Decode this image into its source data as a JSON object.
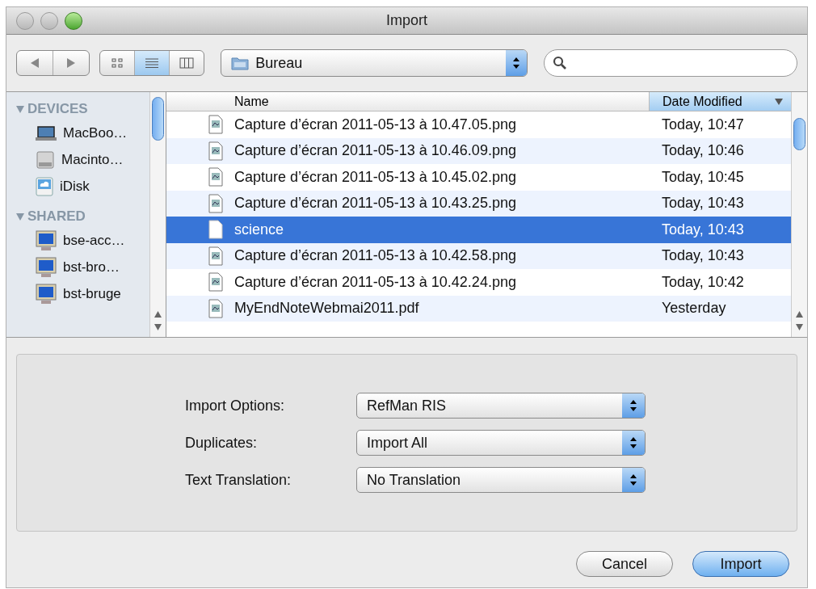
{
  "window": {
    "title": "Import"
  },
  "toolbar": {
    "view_modes": [
      {
        "kind": "icons",
        "selected": false
      },
      {
        "kind": "list",
        "selected": true
      },
      {
        "kind": "columns",
        "selected": false
      }
    ],
    "location": "Bureau"
  },
  "sidebar": {
    "sections": [
      {
        "title": "DEVICES",
        "expanded": true,
        "items": [
          {
            "kind": "laptop",
            "label": "MacBoo…"
          },
          {
            "kind": "disk",
            "label": "Macinto…"
          },
          {
            "kind": "idisk",
            "label": "iDisk"
          }
        ]
      },
      {
        "title": "SHARED",
        "expanded": true,
        "items": [
          {
            "kind": "computer",
            "label": "bse-acc…"
          },
          {
            "kind": "computer",
            "label": "bst-bro…"
          },
          {
            "kind": "computer",
            "label": "bst-bruge"
          }
        ]
      }
    ]
  },
  "table": {
    "columns": [
      {
        "label": "Name",
        "sorted": false
      },
      {
        "label": "Date Modified",
        "sorted": true
      }
    ],
    "rows": [
      {
        "kind": "image",
        "name": "Capture d’écran 2011-05-13 à 10.47.05.png",
        "date": "Today, 10:47",
        "selected": false
      },
      {
        "kind": "image",
        "name": "Capture d’écran 2011-05-13 à 10.46.09.png",
        "date": "Today, 10:46",
        "selected": false
      },
      {
        "kind": "image",
        "name": "Capture d’écran 2011-05-13 à 10.45.02.png",
        "date": "Today, 10:45",
        "selected": false
      },
      {
        "kind": "image",
        "name": "Capture d’écran 2011-05-13 à 10.43.25.png",
        "date": "Today, 10:43",
        "selected": false
      },
      {
        "kind": "blank",
        "name": "science",
        "date": "Today, 10:43",
        "selected": true
      },
      {
        "kind": "image",
        "name": "Capture d’écran 2011-05-13 à 10.42.58.png",
        "date": "Today, 10:43",
        "selected": false
      },
      {
        "kind": "image",
        "name": "Capture d’écran 2011-05-13 à 10.42.24.png",
        "date": "Today, 10:42",
        "selected": false
      },
      {
        "kind": "image",
        "name": "MyEndNoteWebmai2011.pdf",
        "date": "Yesterday",
        "selected": false
      }
    ]
  },
  "options": [
    {
      "label": "Import Options:",
      "value": "RefMan RIS"
    },
    {
      "label": "Duplicates:",
      "value": "Import All"
    },
    {
      "label": "Text Translation:",
      "value": "No Translation"
    }
  ],
  "buttons": [
    {
      "label": "Cancel",
      "default": false
    },
    {
      "label": "Import",
      "default": true
    }
  ]
}
